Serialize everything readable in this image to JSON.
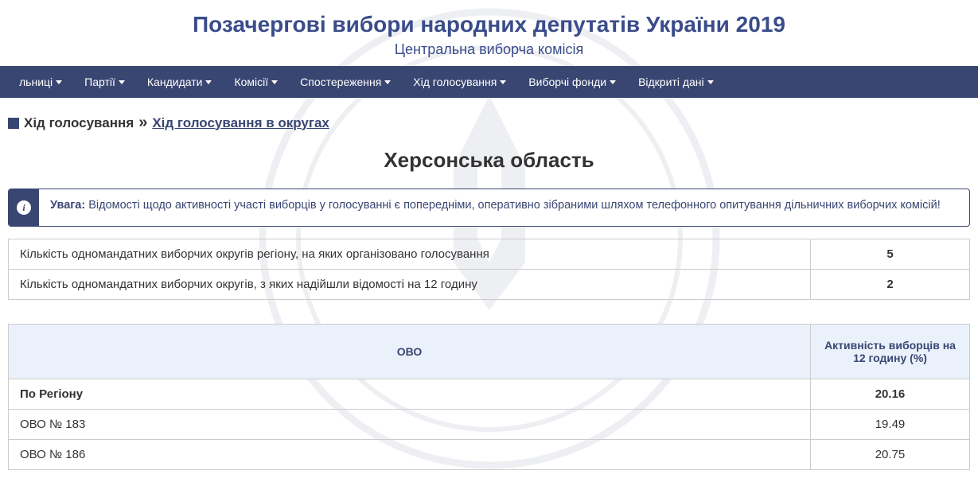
{
  "header": {
    "title": "Позачергові вибори народних депутатів України 2019",
    "subtitle": "Центральна виборча комісія"
  },
  "nav": [
    {
      "label": "льниці",
      "dropdown": true
    },
    {
      "label": "Партії",
      "dropdown": true
    },
    {
      "label": "Кандидати",
      "dropdown": true
    },
    {
      "label": "Комісії",
      "dropdown": true
    },
    {
      "label": "Спостереження",
      "dropdown": true
    },
    {
      "label": "Хід голосування",
      "dropdown": true
    },
    {
      "label": "Виборчі фонди",
      "dropdown": true
    },
    {
      "label": "Відкриті дані",
      "dropdown": true
    }
  ],
  "breadcrumb": {
    "level1": "Хід голосування",
    "separator": "»",
    "level2": "Хід голосування в округах"
  },
  "region_title": "Херсонська область",
  "alert": {
    "bold": "Увага:",
    "text": " Відомості щодо активності участі виборців у голосуванні є попередніми, оперативно зібраними шляхом телефонного опитування дільничних виборчих комісій!"
  },
  "stats": [
    {
      "label": "Кількість одномандатних виборчих округів регіону, на яких організовано голосування",
      "value": "5"
    },
    {
      "label": "Кількість одномандатних виборчих округів, з яких надійшли відомості на 12 годину",
      "value": "2"
    }
  ],
  "data_table": {
    "headers": [
      "ОВО",
      "Активність виборців на 12 годину (%)"
    ],
    "total_row": {
      "label": "По Регіону",
      "value": "20.16"
    },
    "rows": [
      {
        "label": "ОВО № 183",
        "value": "19.49"
      },
      {
        "label": "ОВО № 186",
        "value": "20.75"
      }
    ]
  }
}
